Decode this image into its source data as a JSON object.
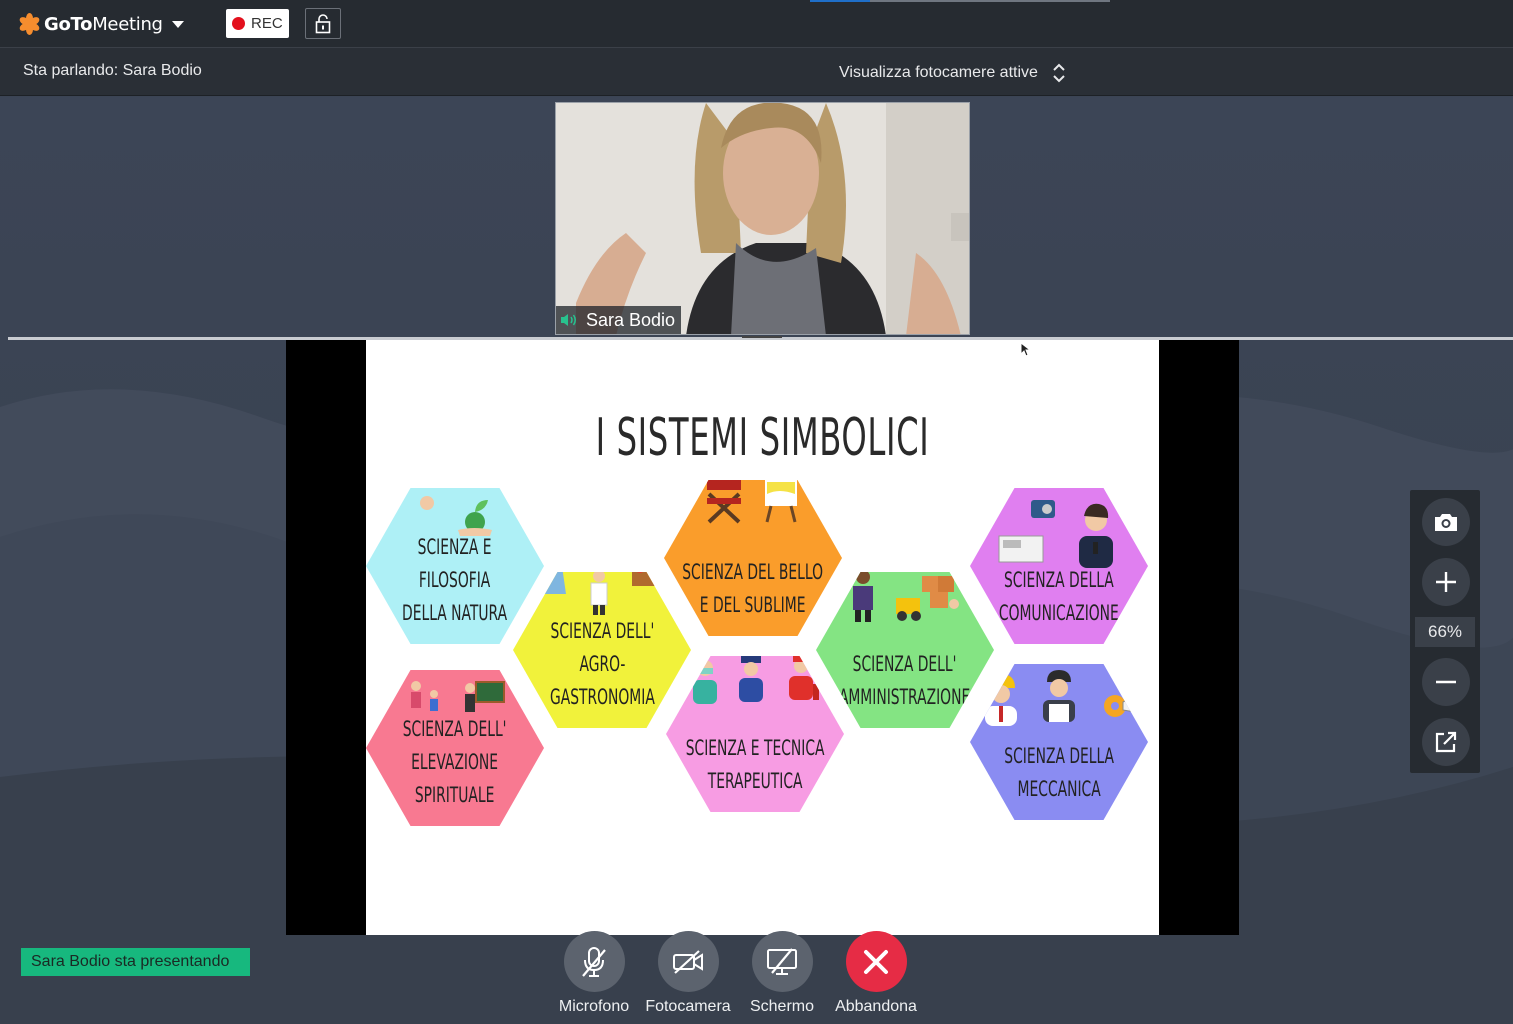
{
  "app": {
    "logo_bold": "GoTo",
    "logo_light": "Meeting",
    "rec_label": "REC"
  },
  "subbar": {
    "speaking": "Sta parlando: Sara Bodio",
    "camera_view": "Visualizza fotocamere attive"
  },
  "video": {
    "participant_name": "Sara Bodio"
  },
  "slide": {
    "title": "I SISTEMI SIMBOLICI",
    "hexes": [
      {
        "lines": [
          "SCIENZA E",
          "FILOSOFIA",
          "DELLA NATURA"
        ],
        "color": "#aef0f6"
      },
      {
        "lines": [
          "SCIENZA DELL'",
          "ELEVAZIONE",
          "SPIRITUALE"
        ],
        "color": "#f87991"
      },
      {
        "lines": [
          "SCIENZA DELL'",
          "AGRO-",
          "GASTRONOMIA"
        ],
        "color": "#f1f23b"
      },
      {
        "lines": [
          "SCIENZA DEL BELLO",
          "E DEL SUBLIME"
        ],
        "color": "#fa9d2b"
      },
      {
        "lines": [
          "SCIENZA E TECNICA",
          "TERAPEUTICA"
        ],
        "color": "#f79ce3"
      },
      {
        "lines": [
          "SCIENZA DELL'",
          "AMMINISTRAZIONE"
        ],
        "color": "#84e483"
      },
      {
        "lines": [
          "SCIENZA DELLA",
          "COMUNICAZIONE"
        ],
        "color": "#e07ff0"
      },
      {
        "lines": [
          "SCIENZA DELLA",
          "MECCANICA"
        ],
        "color": "#8a8cf2"
      }
    ]
  },
  "zoom": {
    "value": "66%"
  },
  "bottom": {
    "presenting": "Sara Bodio sta presentando",
    "controls": {
      "mic": "Microfono",
      "camera": "Fotocamera",
      "screen": "Schermo",
      "leave": "Abbandona"
    }
  },
  "colors": {
    "topbar": "#262b31",
    "accent_orange": "#f68d2e",
    "rec_red": "#e3101d",
    "presenting_green": "#17b87e",
    "leave_red": "#e62c45"
  }
}
